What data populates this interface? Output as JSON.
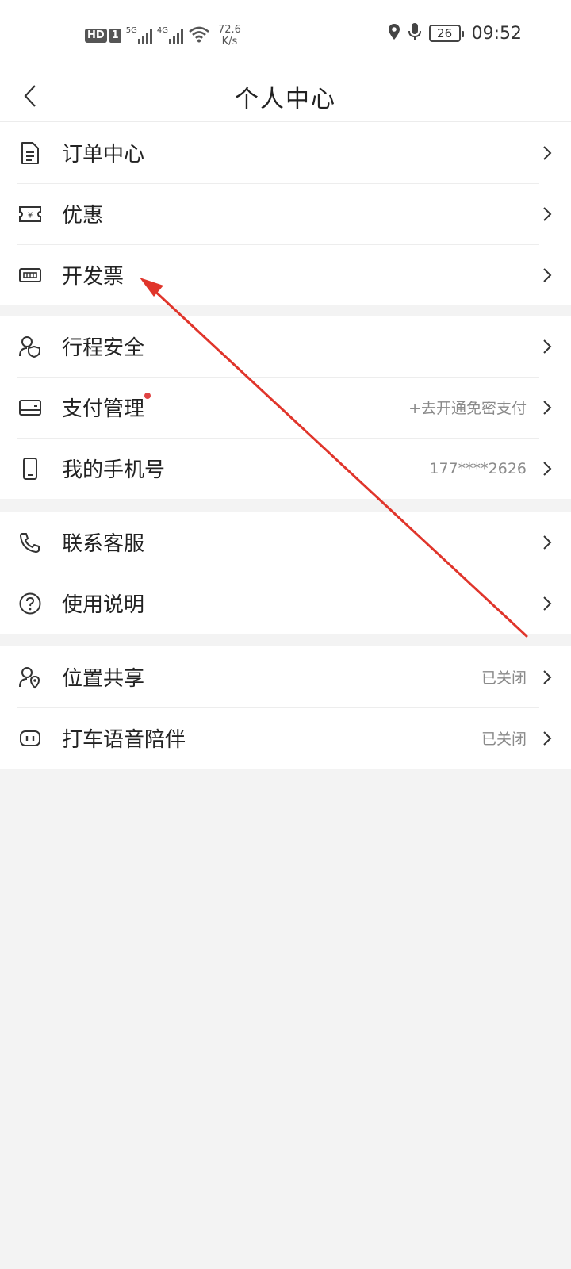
{
  "status_bar": {
    "hd": "HD",
    "sim": "1",
    "net1": "5G",
    "net2": "4G",
    "speed_value": "72.6",
    "speed_unit": "K/s",
    "battery": "26",
    "time": "09:52"
  },
  "header": {
    "title": "个人中心"
  },
  "groups": [
    {
      "items": [
        {
          "label": "订单中心",
          "value": "",
          "icon": "document-icon"
        },
        {
          "label": "优惠",
          "value": "",
          "icon": "coupon-icon"
        },
        {
          "label": "开发票",
          "value": "",
          "icon": "invoice-icon"
        }
      ]
    },
    {
      "items": [
        {
          "label": "行程安全",
          "value": "",
          "icon": "user-shield-icon"
        },
        {
          "label": "支付管理",
          "value": "+去开通免密支付",
          "icon": "card-icon"
        },
        {
          "label": "我的手机号",
          "value": "177****2626",
          "icon": "phone-icon"
        }
      ]
    },
    {
      "items": [
        {
          "label": "联系客服",
          "value": "",
          "icon": "call-icon"
        },
        {
          "label": "使用说明",
          "value": "",
          "icon": "help-icon"
        }
      ]
    },
    {
      "items": [
        {
          "label": "位置共享",
          "value": "已关闭",
          "icon": "location-share-icon"
        },
        {
          "label": "打车语音陪伴",
          "value": "已关闭",
          "icon": "voice-companion-icon"
        }
      ]
    }
  ],
  "colors": {
    "background": "#f3f3f3",
    "card": "#ffffff",
    "annotation_arrow": "#e0352b",
    "badge_dot": "#e04444"
  }
}
